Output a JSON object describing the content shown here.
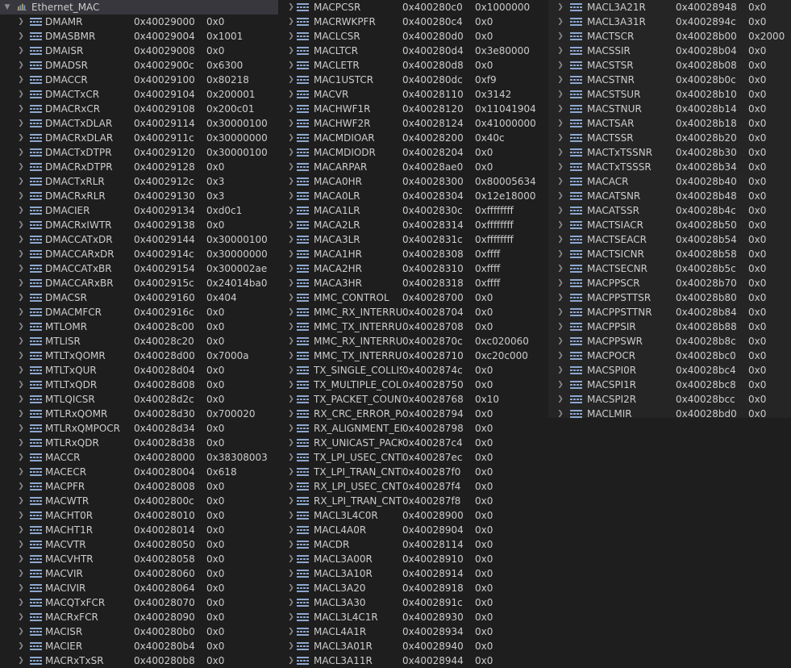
{
  "root": {
    "name": "Ethernet_MAC"
  },
  "columns": [
    [
      [
        "DMAMR",
        "0x40029000",
        "0x0"
      ],
      [
        "DMASBMR",
        "0x40029004",
        "0x1001"
      ],
      [
        "DMAISR",
        "0x40029008",
        "0x0"
      ],
      [
        "DMADSR",
        "0x4002900c",
        "0x6300"
      ],
      [
        "DMACCR",
        "0x40029100",
        "0x80218"
      ],
      [
        "DMACTxCR",
        "0x40029104",
        "0x200001"
      ],
      [
        "DMACRxCR",
        "0x40029108",
        "0x200c01"
      ],
      [
        "DMACTxDLAR",
        "0x40029114",
        "0x30000100"
      ],
      [
        "DMACRxDLAR",
        "0x4002911c",
        "0x30000000"
      ],
      [
        "DMACTxDTPR",
        "0x40029120",
        "0x30000100"
      ],
      [
        "DMACRxDTPR",
        "0x40029128",
        "0x0"
      ],
      [
        "DMACTxRLR",
        "0x4002912c",
        "0x3"
      ],
      [
        "DMACRxRLR",
        "0x40029130",
        "0x3"
      ],
      [
        "DMACIER",
        "0x40029134",
        "0xd0c1"
      ],
      [
        "DMACRxIWTR",
        "0x40029138",
        "0x0"
      ],
      [
        "DMACCATxDR",
        "0x40029144",
        "0x30000100"
      ],
      [
        "DMACCARxDR",
        "0x4002914c",
        "0x30000000"
      ],
      [
        "DMACCATxBR",
        "0x40029154",
        "0x300002ae"
      ],
      [
        "DMACCARxBR",
        "0x4002915c",
        "0x24014ba0"
      ],
      [
        "DMACSR",
        "0x40029160",
        "0x404"
      ],
      [
        "DMACMFCR",
        "0x4002916c",
        "0x0"
      ],
      [
        "MTLOMR",
        "0x40028c00",
        "0x0"
      ],
      [
        "MTLISR",
        "0x40028c20",
        "0x0"
      ],
      [
        "MTLTxQOMR",
        "0x40028d00",
        "0x7000a"
      ],
      [
        "MTLTxQUR",
        "0x40028d04",
        "0x0"
      ],
      [
        "MTLTxQDR",
        "0x40028d08",
        "0x0"
      ],
      [
        "MTLQICSR",
        "0x40028d2c",
        "0x0"
      ],
      [
        "MTLRxQOMR",
        "0x40028d30",
        "0x700020"
      ],
      [
        "MTLRxQMPOCR",
        "0x40028d34",
        "0x0"
      ],
      [
        "MTLRxQDR",
        "0x40028d38",
        "0x0"
      ],
      [
        "MACCR",
        "0x40028000",
        "0x38308003"
      ],
      [
        "MACECR",
        "0x40028004",
        "0x618"
      ],
      [
        "MACPFR",
        "0x40028008",
        "0x0"
      ],
      [
        "MACWTR",
        "0x4002800c",
        "0x0"
      ],
      [
        "MACHT0R",
        "0x40028010",
        "0x0"
      ],
      [
        "MACHT1R",
        "0x40028014",
        "0x0"
      ],
      [
        "MACVTR",
        "0x40028050",
        "0x0"
      ],
      [
        "MACVHTR",
        "0x40028058",
        "0x0"
      ],
      [
        "MACVIR",
        "0x40028060",
        "0x0"
      ],
      [
        "MACIVIR",
        "0x40028064",
        "0x0"
      ],
      [
        "MACQTxFCR",
        "0x40028070",
        "0x0"
      ],
      [
        "MACRxFCR",
        "0x40028090",
        "0x0"
      ],
      [
        "MACISR",
        "0x400280b0",
        "0x0"
      ],
      [
        "MACIER",
        "0x400280b4",
        "0x0"
      ],
      [
        "MACRxTxSR",
        "0x400280b8",
        "0x0"
      ]
    ],
    [
      [
        "MACPCSR",
        "0x400280c0",
        "0x1000000"
      ],
      [
        "MACRWKPFR",
        "0x400280c4",
        "0x0"
      ],
      [
        "MACLCSR",
        "0x400280d0",
        "0x0"
      ],
      [
        "MACLTCR",
        "0x400280d4",
        "0x3e80000"
      ],
      [
        "MACLETR",
        "0x400280d8",
        "0x0"
      ],
      [
        "MAC1USTCR",
        "0x400280dc",
        "0xf9"
      ],
      [
        "MACVR",
        "0x40028110",
        "0x3142"
      ],
      [
        "MACHWF1R",
        "0x40028120",
        "0x11041904"
      ],
      [
        "MACHWF2R",
        "0x40028124",
        "0x41000000"
      ],
      [
        "MACMDIOAR",
        "0x40028200",
        "0x40c"
      ],
      [
        "MACMDIODR",
        "0x40028204",
        "0x0"
      ],
      [
        "MACARPAR",
        "0x40028ae0",
        "0x0"
      ],
      [
        "MACA0HR",
        "0x40028300",
        "0x80005634"
      ],
      [
        "MACA0LR",
        "0x40028304",
        "0x12e18000"
      ],
      [
        "MACA1LR",
        "0x4002830c",
        "0xffffffff"
      ],
      [
        "MACA2LR",
        "0x40028314",
        "0xffffffff"
      ],
      [
        "MACA3LR",
        "0x4002831c",
        "0xffffffff"
      ],
      [
        "MACA1HR",
        "0x40028308",
        "0xffff"
      ],
      [
        "MACA2HR",
        "0x40028310",
        "0xffff"
      ],
      [
        "MACA3HR",
        "0x40028318",
        "0xffff"
      ],
      [
        "MMC_CONTROL",
        "0x40028700",
        "0x0"
      ],
      [
        "MMC_RX_INTERRUP",
        "0x40028704",
        "0x0"
      ],
      [
        "MMC_TX_INTERRUP",
        "0x40028708",
        "0x0"
      ],
      [
        "MMC_RX_INTERRUP",
        "0x4002870c",
        "0xc020060"
      ],
      [
        "MMC_TX_INTERRUP",
        "0x40028710",
        "0xc20c000"
      ],
      [
        "TX_SINGLE_COLLISI",
        "0x4002874c",
        "0x0"
      ],
      [
        "TX_MULTIPLE_COLL",
        "0x40028750",
        "0x0"
      ],
      [
        "TX_PACKET_COUNT_",
        "0x40028768",
        "0x10"
      ],
      [
        "RX_CRC_ERROR_PAC",
        "0x40028794",
        "0x0"
      ],
      [
        "RX_ALIGNMENT_ERI",
        "0x40028798",
        "0x0"
      ],
      [
        "RX_UNICAST_PACKE",
        "0x400287c4",
        "0x0"
      ],
      [
        "TX_LPI_USEC_CNTR",
        "0x400287ec",
        "0x0"
      ],
      [
        "TX_LPI_TRAN_CNTR",
        "0x400287f0",
        "0x0"
      ],
      [
        "RX_LPI_USEC_CNTR",
        "0x400287f4",
        "0x0"
      ],
      [
        "RX_LPI_TRAN_CNTR",
        "0x400287f8",
        "0x0"
      ],
      [
        "MACL3L4C0R",
        "0x40028900",
        "0x0"
      ],
      [
        "MACL4A0R",
        "0x40028904",
        "0x0"
      ],
      [
        "MACDR",
        "0x40028114",
        "0x0"
      ],
      [
        "MACL3A00R",
        "0x40028910",
        "0x0"
      ],
      [
        "MACL3A10R",
        "0x40028914",
        "0x0"
      ],
      [
        "MACL3A20",
        "0x40028918",
        "0x0"
      ],
      [
        "MACL3A30",
        "0x4002891c",
        "0x0"
      ],
      [
        "MACL3L4C1R",
        "0x40028930",
        "0x0"
      ],
      [
        "MACL4A1R",
        "0x40028934",
        "0x0"
      ],
      [
        "MACL3A01R",
        "0x40028940",
        "0x0"
      ],
      [
        "MACL3A11R",
        "0x40028944",
        "0x0"
      ]
    ],
    [
      [
        "MACL3A21R",
        "0x40028948",
        "0x0"
      ],
      [
        "MACL3A31R",
        "0x4002894c",
        "0x0"
      ],
      [
        "MACTSCR",
        "0x40028b00",
        "0x2000"
      ],
      [
        "MACSSIR",
        "0x40028b04",
        "0x0"
      ],
      [
        "MACSTSR",
        "0x40028b08",
        "0x0"
      ],
      [
        "MACSTNR",
        "0x40028b0c",
        "0x0"
      ],
      [
        "MACSTSUR",
        "0x40028b10",
        "0x0"
      ],
      [
        "MACSTNUR",
        "0x40028b14",
        "0x0"
      ],
      [
        "MACTSAR",
        "0x40028b18",
        "0x0"
      ],
      [
        "MACTSSR",
        "0x40028b20",
        "0x0"
      ],
      [
        "MACTxTSSNR",
        "0x40028b30",
        "0x0"
      ],
      [
        "MACTxTSSSR",
        "0x40028b34",
        "0x0"
      ],
      [
        "MACACR",
        "0x40028b40",
        "0x0"
      ],
      [
        "MACATSNR",
        "0x40028b48",
        "0x0"
      ],
      [
        "MACATSSR",
        "0x40028b4c",
        "0x0"
      ],
      [
        "MACTSIACR",
        "0x40028b50",
        "0x0"
      ],
      [
        "MACTSEACR",
        "0x40028b54",
        "0x0"
      ],
      [
        "MACTSICNR",
        "0x40028b58",
        "0x0"
      ],
      [
        "MACTSECNR",
        "0x40028b5c",
        "0x0"
      ],
      [
        "MACPPSCR",
        "0x40028b70",
        "0x0"
      ],
      [
        "MACPPSTTSR",
        "0x40028b80",
        "0x0"
      ],
      [
        "MACPPSTTNR",
        "0x40028b84",
        "0x0"
      ],
      [
        "MACPPSIR",
        "0x40028b88",
        "0x0"
      ],
      [
        "MACPPSWR",
        "0x40028b8c",
        "0x0"
      ],
      [
        "MACPOCR",
        "0x40028bc0",
        "0x0"
      ],
      [
        "MACSPI0R",
        "0x40028bc4",
        "0x0"
      ],
      [
        "MACSPI1R",
        "0x40028bc8",
        "0x0"
      ],
      [
        "MACSPI2R",
        "0x40028bcc",
        "0x0"
      ],
      [
        "MACLMIR",
        "0x40028bd0",
        "0x0"
      ]
    ]
  ]
}
